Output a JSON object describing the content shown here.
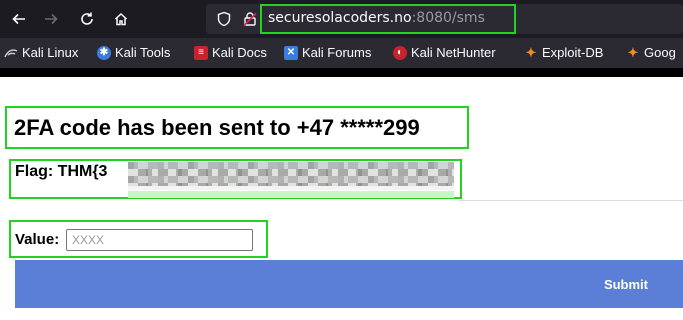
{
  "browser": {
    "url_host": "securesolacoders.no",
    "url_rest": ":8080/sms"
  },
  "bookmarks": [
    {
      "label": "Kali Linux",
      "icon": "kali-dragon-icon"
    },
    {
      "label": "Kali Tools",
      "icon": "kali-tools-icon"
    },
    {
      "label": "Kali Docs",
      "icon": "kali-docs-icon"
    },
    {
      "label": "Kali Forums",
      "icon": "kali-forums-icon"
    },
    {
      "label": "Kali NetHunter",
      "icon": "nethunter-icon"
    },
    {
      "label": "Exploit-DB",
      "icon": "exploit-db-icon"
    },
    {
      "label": "Goog",
      "icon": "google-hacking-icon"
    }
  ],
  "page": {
    "heading": "2FA code has been sent to +47 *****299",
    "flag_label": "Flag: THM{3",
    "value_label": "Value:",
    "value_placeholder": "XXXX",
    "submit_label": "Submit"
  },
  "colors": {
    "highlight": "#22d422",
    "submit_bg": "#5b7fd6"
  }
}
